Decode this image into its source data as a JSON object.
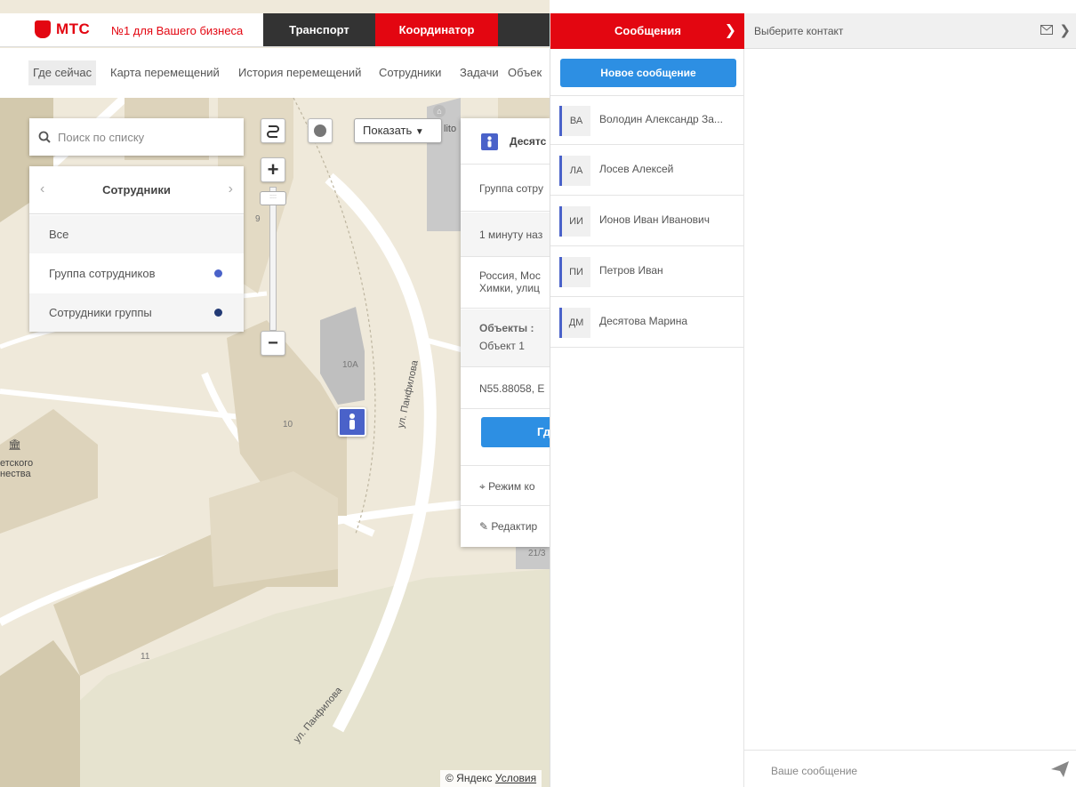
{
  "header": {
    "logo_text": "МТС",
    "slogan": "№1 для Вашего бизнеса",
    "tabs": [
      {
        "label": "Транспорт",
        "active": false
      },
      {
        "label": "Координатор",
        "active": true
      }
    ]
  },
  "subnav": {
    "items": [
      {
        "label": "Где сейчас",
        "active": true
      },
      {
        "label": "Карта перемещений"
      },
      {
        "label": "История перемещений"
      },
      {
        "label": "Сотрудники"
      },
      {
        "label": "Задачи"
      },
      {
        "label": "Объек"
      }
    ]
  },
  "search": {
    "placeholder": "Поиск по списку",
    "value": ""
  },
  "employees_panel": {
    "title": "Сотрудники",
    "rows": [
      {
        "label": "Все"
      },
      {
        "label": "Группа сотрудников",
        "dot_color": "#4a62c9"
      },
      {
        "label": "Сотрудники группы",
        "dot_color": "#233a75"
      }
    ]
  },
  "map_controls": {
    "show_button": "Показать",
    "zoom_tick": "9"
  },
  "person_card": {
    "name": "Десятс",
    "group": "Группа сотру",
    "time": "1 минуту наз",
    "address_line1": "Россия, Мос",
    "address_line2": "Химки, улиц",
    "objects_label": "Объекты :",
    "object_value": "Объект 1",
    "coords": "N55.88058, E",
    "where_button": "Гд",
    "mode_label": "Режим ко",
    "edit_label": "Редактир"
  },
  "map_labels": {
    "building_10a": "10А",
    "building_10": "10",
    "building_11": "11",
    "building_9": "9",
    "building_21_3": "21/3",
    "street_1": "ул. Панфилова",
    "street_2": "ул. Панфилова",
    "poi_top": "lito",
    "poi_left_1": "етского",
    "poi_left_2": "нества",
    "copyright": "© Яндекс",
    "terms": "Условия"
  },
  "messages": {
    "title": "Сообщения",
    "new_message_button": "Новое сообщение",
    "contacts": [
      {
        "initials": "ВА",
        "name": "Володин Александр За..."
      },
      {
        "initials": "ЛА",
        "name": "Лосев Алексей"
      },
      {
        "initials": "ИИ",
        "name": "Ионов Иван Иванович"
      },
      {
        "initials": "ПИ",
        "name": "Петров Иван"
      },
      {
        "initials": "ДМ",
        "name": "Десятова Марина"
      }
    ]
  },
  "chat": {
    "title": "Выберите контакт",
    "input_placeholder": "Ваше сообщение"
  },
  "colors": {
    "brand_red": "#e30611",
    "accent_blue": "#2d8fe3",
    "marker_blue": "#4a62c9",
    "dark_tab": "#333333"
  }
}
